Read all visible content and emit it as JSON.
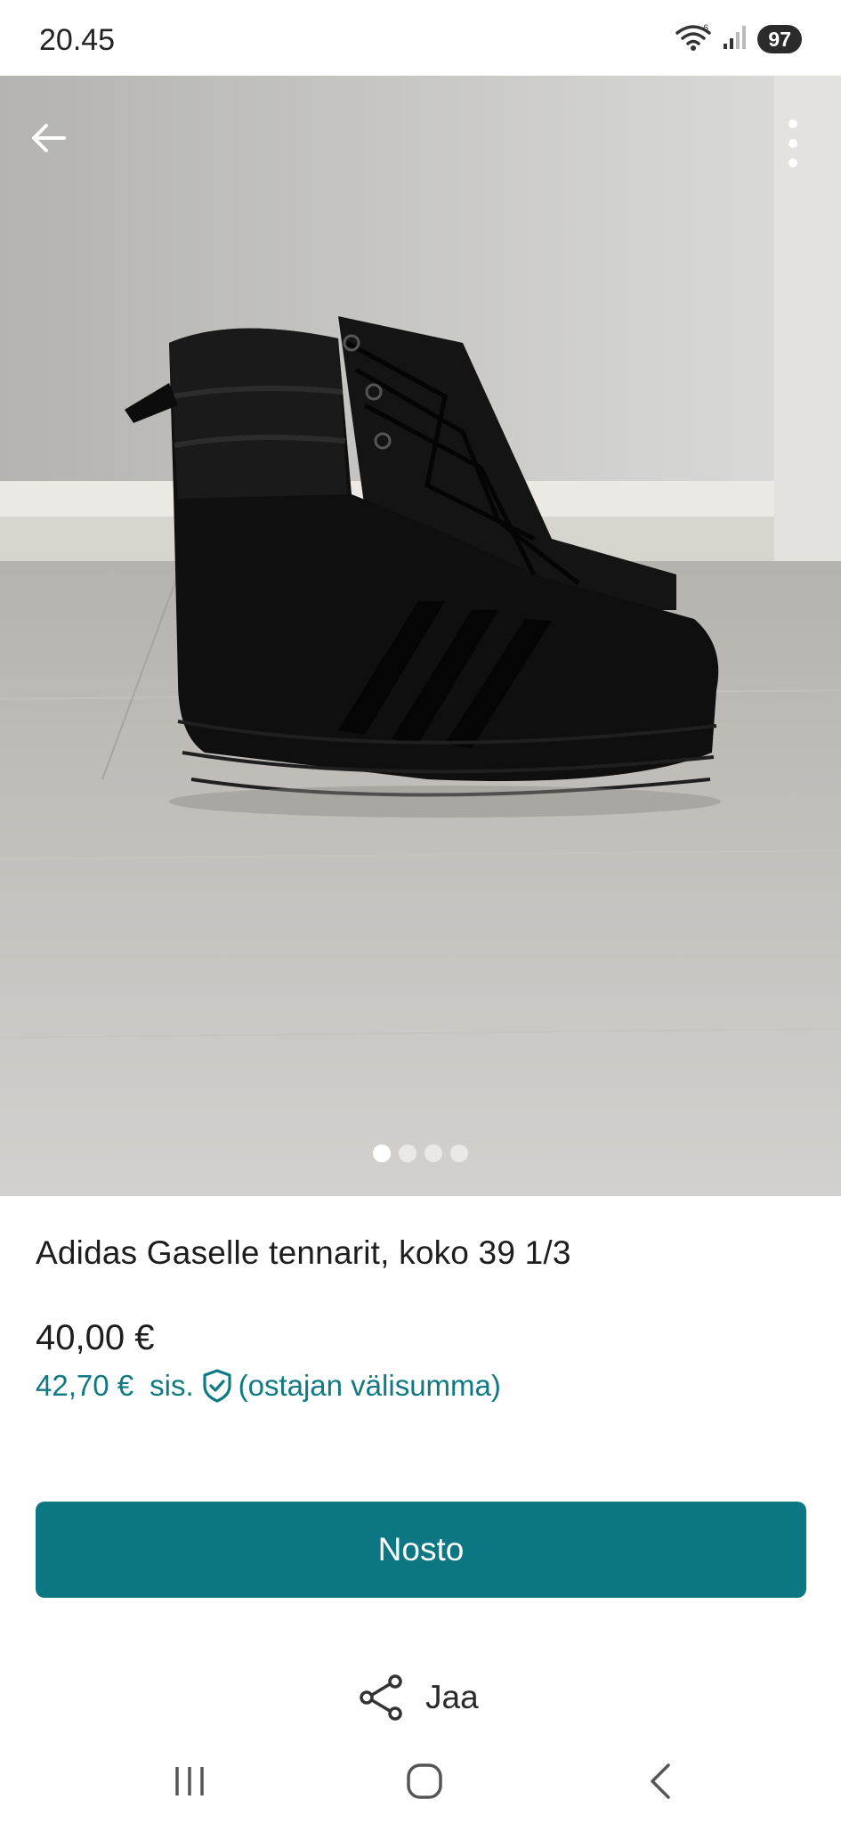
{
  "status_bar": {
    "time": "20.45",
    "battery": "97",
    "wifi_badge": "6"
  },
  "listing": {
    "title": "Adidas Gaselle tennarit, koko 39 1/3",
    "price": "40,00 €",
    "buyer_total": "42,70 €",
    "buyer_includes": "sis.",
    "buyer_note": "(ostajan välisumma)",
    "image_count": 4,
    "active_image": 1
  },
  "actions": {
    "primary_label": "Nosto",
    "share_label": "Jaa"
  },
  "colors": {
    "accent": "#0c7782",
    "buyer_text": "#0f7a83"
  },
  "icons": [
    "back-arrow-icon",
    "more-vertical-icon",
    "shield-check-icon",
    "share-icon",
    "recents-icon",
    "home-icon",
    "nav-back-icon",
    "wifi-icon",
    "signal-icon"
  ]
}
